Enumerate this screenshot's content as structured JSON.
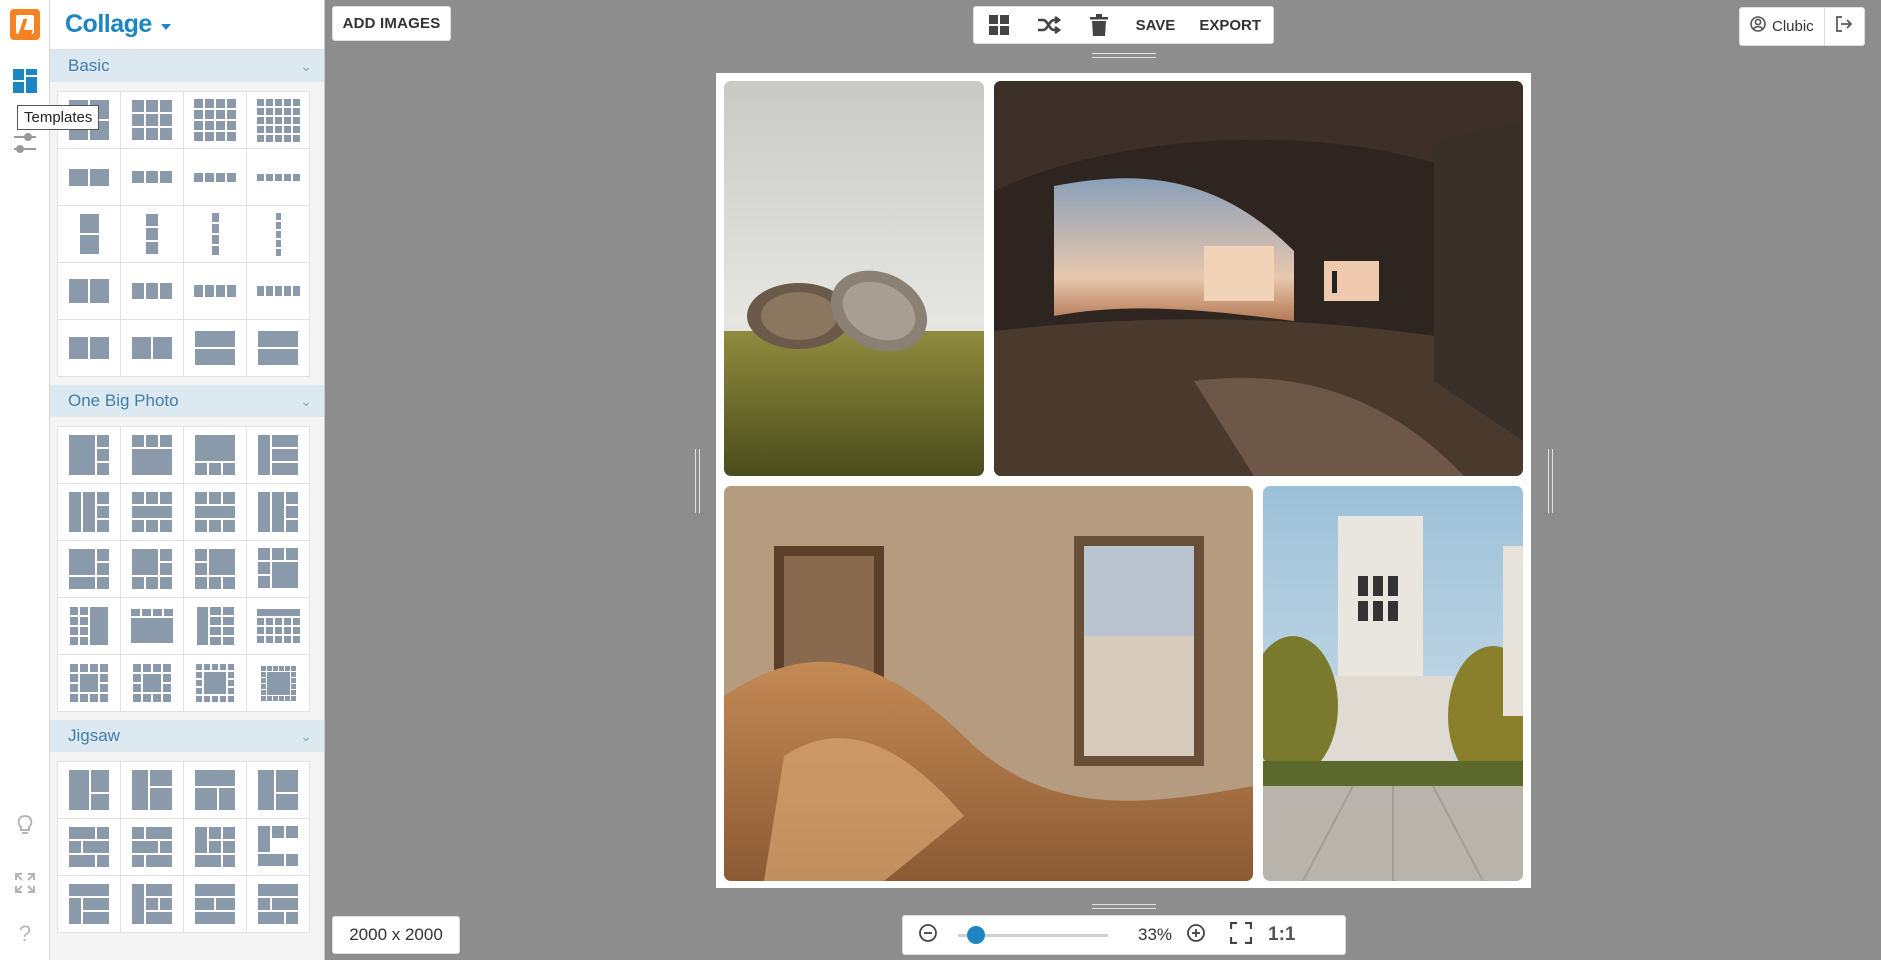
{
  "app": {
    "title": "Collage"
  },
  "rail": {
    "tooltip": "Templates"
  },
  "sidebar": {
    "sections": [
      {
        "label": "Basic"
      },
      {
        "label": "One Big Photo"
      },
      {
        "label": "Jigsaw"
      }
    ]
  },
  "toolbar": {
    "add_images_label": "ADD IMAGES",
    "save_label": "SAVE",
    "export_label": "EXPORT"
  },
  "user": {
    "name": "Clubic"
  },
  "footer": {
    "canvas_size": "2000 x 2000",
    "zoom_percent": "33%",
    "zoom_fraction": 0.06,
    "ratio_label": "1:1"
  },
  "colors": {
    "accent": "#1b86c2",
    "logo": "#f58220",
    "thumb": "#8a9aab",
    "section_bg": "#dde9f1"
  },
  "icons": [
    "templates-icon",
    "adjust-icon",
    "grid-icon",
    "shuffle-icon",
    "trash-icon",
    "user-icon",
    "logout-icon",
    "zoom-out-icon",
    "zoom-in-icon",
    "fullscreen-icon",
    "bulb-icon",
    "expand-icon",
    "help-icon"
  ]
}
